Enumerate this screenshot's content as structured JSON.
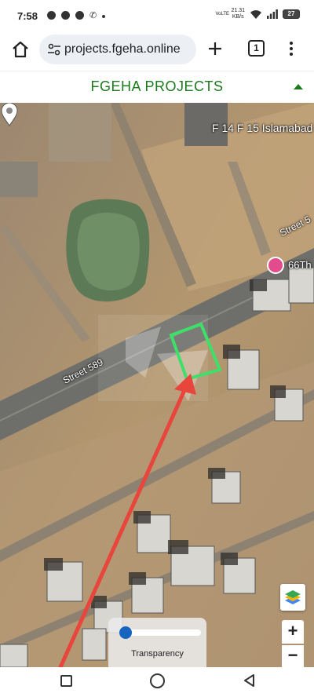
{
  "status_bar": {
    "time": "7:58",
    "network": "VoLTE",
    "speed_value": "21.31",
    "speed_unit": "KB/s",
    "battery": "27"
  },
  "browser": {
    "url": "projects.fgeha.online",
    "tab_count": "1",
    "icons": [
      "home-icon",
      "site-settings-icon",
      "new-tab-icon",
      "tabs-icon",
      "overflow-menu-icon"
    ]
  },
  "page": {
    "title": "FGEHA PROJECTS",
    "accent_color": "#1c7b1c"
  },
  "map": {
    "labels": {
      "sector": "F 14 F 15 Islamabad",
      "street_main": "Street 589",
      "street_other": "Street 5",
      "poi": "66Th"
    },
    "zoom_in_label": "+",
    "zoom_out_label": "−",
    "transparency": {
      "label": "Transparency",
      "value": 0
    },
    "plot_outline_color": "#3ee06a",
    "annotation_arrow_color": "#e8453c"
  },
  "nav": {
    "icons": [
      "recents-icon",
      "home-circle-icon",
      "back-icon"
    ]
  }
}
